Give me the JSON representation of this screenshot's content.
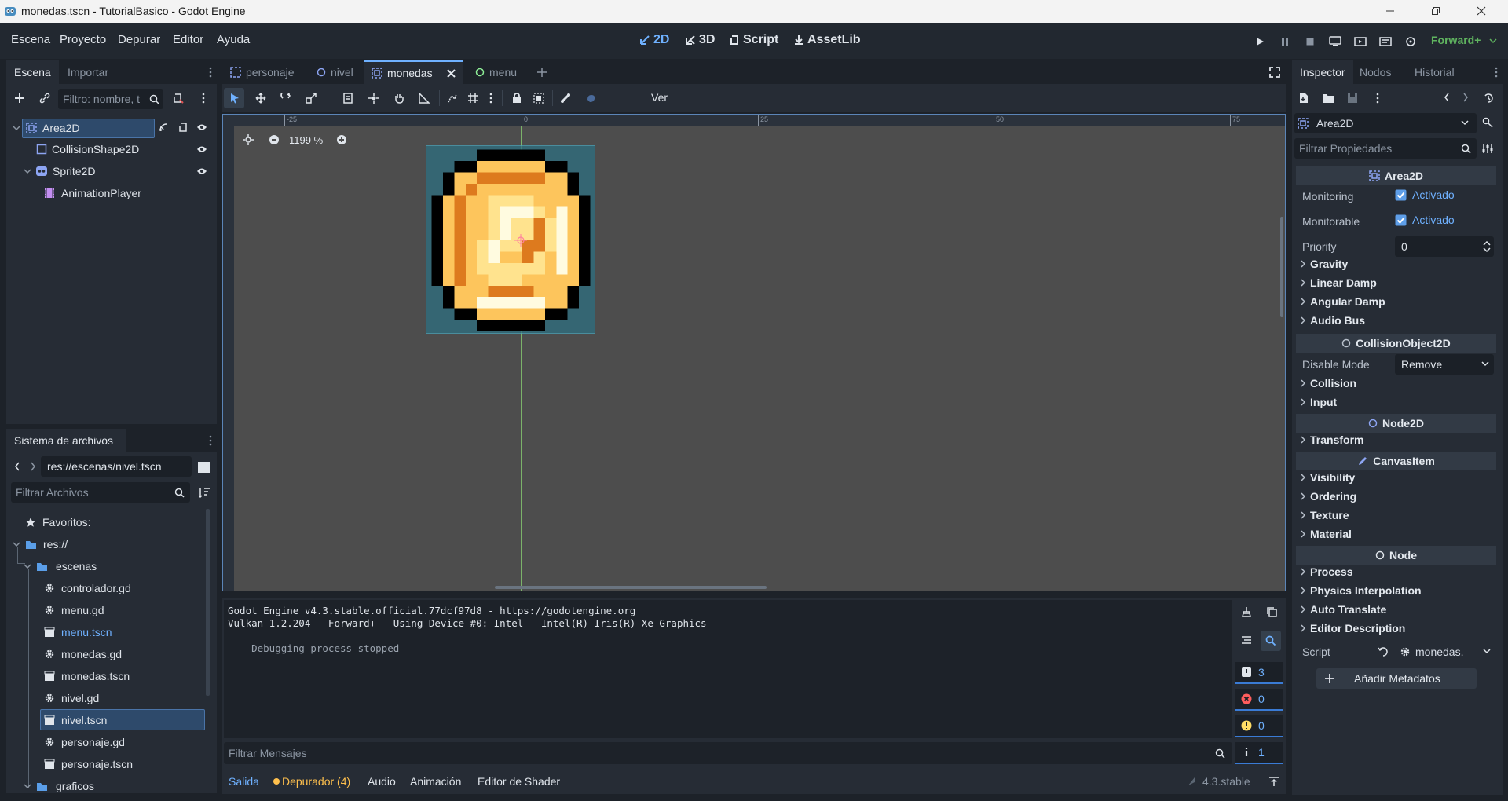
{
  "window": {
    "title": "monedas.tscn - TutorialBasico - Godot Engine"
  },
  "menu": [
    "Escena",
    "Proyecto",
    "Depurar",
    "Editor",
    "Ayuda"
  ],
  "workspaces": {
    "w2d": "2D",
    "w3d": "3D",
    "script": "Script",
    "assetlib": "AssetLib"
  },
  "renderer": "Forward+",
  "scene_dock": {
    "tabs": [
      "Escena",
      "Importar"
    ],
    "filter_placeholder": "Filtro: nombre, t",
    "nodes": [
      "Area2D",
      "CollisionShape2D",
      "Sprite2D",
      "AnimationPlayer"
    ]
  },
  "filesystem_dock": {
    "title": "Sistema de archivos",
    "path": "res://escenas/nivel.tscn",
    "filter_placeholder": "Filtrar Archivos",
    "items": [
      "Favoritos:",
      "res://",
      "escenas",
      "controlador.gd",
      "menu.gd",
      "menu.tscn",
      "monedas.gd",
      "monedas.tscn",
      "nivel.gd",
      "nivel.tscn",
      "personaje.gd",
      "personaje.tscn",
      "graficos"
    ]
  },
  "scene_tabs": [
    "personaje",
    "nivel",
    "monedas",
    "menu"
  ],
  "toolbar": {
    "view_label": "Ver"
  },
  "viewport": {
    "zoom": "1199 %",
    "ruler": [
      "-25",
      "0",
      "25",
      "50",
      "75"
    ]
  },
  "output": {
    "lines": [
      "Godot Engine v4.3.stable.official.77dcf97d8 - https://godotengine.org",
      "Vulkan 1.2.204 - Forward+ - Using Device #0: Intel - Intel(R) Iris(R) Xe Graphics",
      "",
      "--- Debugging process stopped ---"
    ],
    "filter_placeholder": "Filtrar Mensajes",
    "counts": {
      "messages": "3",
      "errors": "0",
      "warnings": "0",
      "info": "1"
    }
  },
  "bottom_tabs": [
    "Salida",
    "Depurador (4)",
    "Audio",
    "Animación",
    "Editor de Shader"
  ],
  "version": "4.3.stable",
  "inspector": {
    "tabs": [
      "Inspector",
      "Nodos",
      "Historial"
    ],
    "object": "Area2D",
    "filter_placeholder": "Filtrar Propiedades",
    "sections": {
      "area2d": "Area2D",
      "collision_object": "CollisionObject2D",
      "node2d": "Node2D",
      "canvas_item": "CanvasItem",
      "node": "Node"
    },
    "props": {
      "monitoring_label": "Monitoring",
      "monitoring_value": "Activado",
      "monitorable_label": "Monitorable",
      "monitorable_value": "Activado",
      "priority_label": "Priority",
      "priority_value": "0",
      "disable_mode_label": "Disable Mode",
      "disable_mode_value": "Remove",
      "script_label": "Script",
      "script_value": "monedas."
    },
    "groups_a": [
      "Gravity",
      "Linear Damp",
      "Angular Damp",
      "Audio Bus"
    ],
    "groups_b": [
      "Collision",
      "Input"
    ],
    "groups_c": [
      "Transform"
    ],
    "groups_d": [
      "Visibility",
      "Ordering",
      "Texture",
      "Material"
    ],
    "groups_e": [
      "Process",
      "Physics Interpolation",
      "Auto Translate",
      "Editor Description"
    ],
    "add_metadata": "Añadir Metadatos"
  },
  "colors": {
    "accent": "#6fb1ff",
    "selection": "#2e4a6b",
    "viewport_bg": "#4d4d4d",
    "coin_fill": "#ffc04d"
  }
}
